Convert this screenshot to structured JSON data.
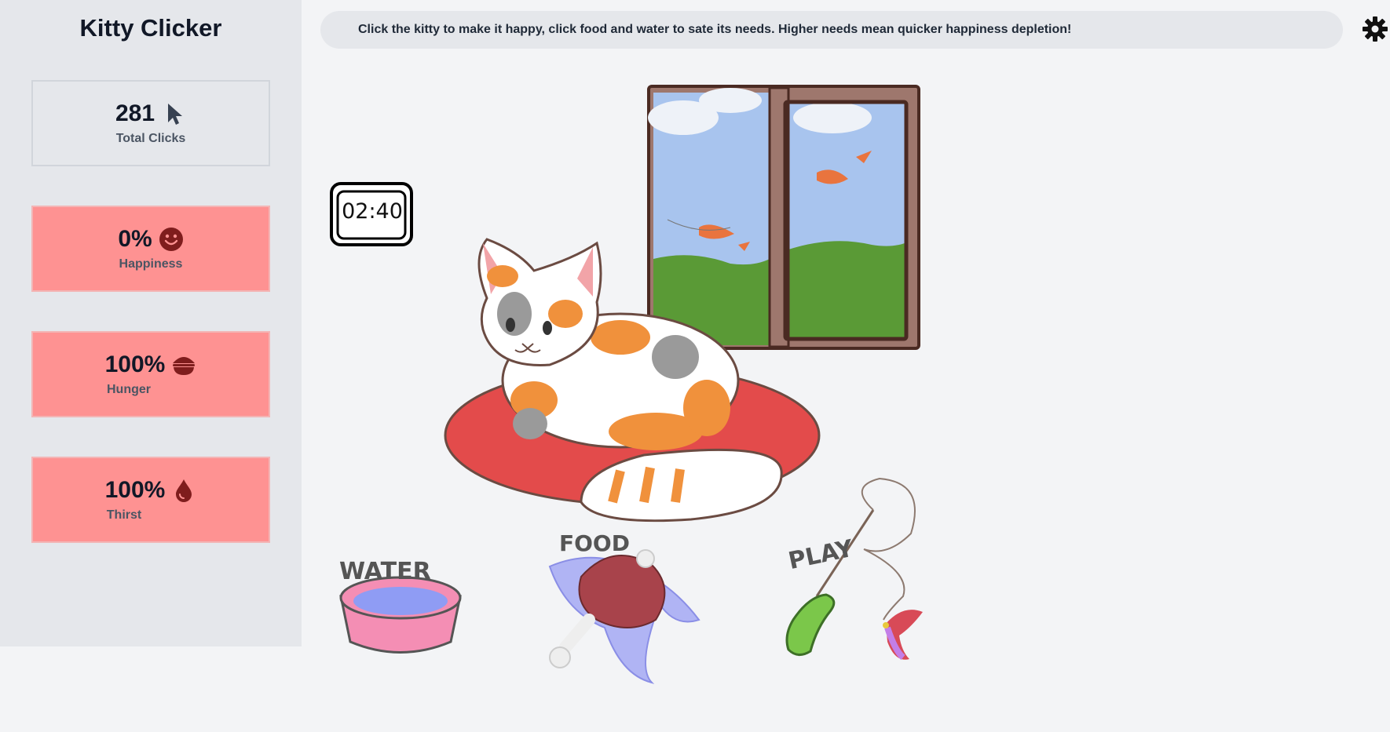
{
  "app": {
    "title": "Kitty Clicker"
  },
  "banner": {
    "text": "Click the kitty to make it happy, click food and water to sate its needs. Higher needs mean quicker happiness depletion!"
  },
  "settings": {
    "icon": "gear-icon"
  },
  "stats": {
    "clicks": {
      "value": "281",
      "label": "Total Clicks",
      "icon": "cursor-icon"
    },
    "happiness": {
      "value": "0%",
      "label": "Happiness",
      "icon": "smiley-icon"
    },
    "hunger": {
      "value": "100%",
      "label": "Hunger",
      "icon": "food-bowl-icon"
    },
    "thirst": {
      "value": "100%",
      "label": "Thirst",
      "icon": "water-drop-icon"
    }
  },
  "clock": {
    "time": "02:40"
  },
  "scene": {
    "water_label": "WATER",
    "food_label": "FOOD",
    "play_label": "PLAY"
  },
  "colors": {
    "alert_card": "#fe9292",
    "icon_dark_red": "#7f1d1d",
    "cat_bed": "#e34b4b",
    "cat_patch_orange": "#f0913c",
    "cat_patch_gray": "#9a9a9a"
  }
}
